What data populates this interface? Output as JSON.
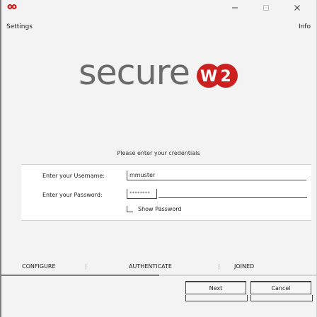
{
  "window": {
    "minimize_icon": "minimize-icon",
    "maximize_icon": "maximize-icon",
    "close_icon": "close-icon",
    "app_icon": "app-icon",
    "accent_color": "#cc1f1f"
  },
  "header": {
    "settings_label": "Settings",
    "info_label": "Info"
  },
  "logo": {
    "text": "secure",
    "badge_letters": [
      "W",
      "2"
    ],
    "badge_color": "#cc1f1f"
  },
  "form": {
    "prompt": "Please enter your credentials",
    "username_label": "Enter your Username:",
    "username_value": "mmuster",
    "password_label": "Enter your Password:",
    "password_value": "********",
    "show_password_label": "Show Password",
    "show_password_checked": false
  },
  "steps": {
    "items": [
      "CONFIGURE",
      "AUTHENTICATE",
      "JOINED"
    ],
    "separator": "|",
    "active_index": 1,
    "progress_fraction": 0.5
  },
  "buttons": {
    "next_label": "Next",
    "cancel_label": "Cancel"
  }
}
